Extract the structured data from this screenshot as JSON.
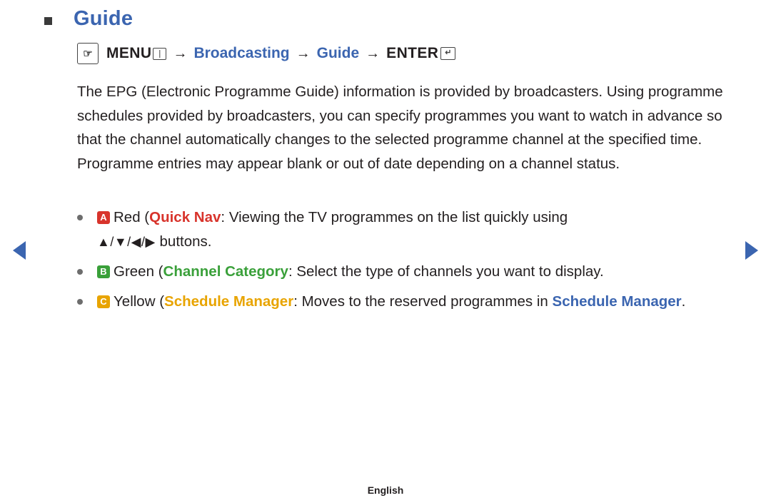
{
  "page": {
    "title": "Guide",
    "footer": "English"
  },
  "menu_path": {
    "hand_icon": "hand-pointer-icon",
    "menu_label": "MENU",
    "menu_key_icon": "menu-key-icon",
    "arrow": "→",
    "broadcasting_label": "Broadcasting",
    "guide_label": "Guide",
    "enter_label": "ENTER",
    "enter_key_icon": "enter-key-icon"
  },
  "paragraph": "The EPG (Electronic Programme Guide) information is provided by broadcasters. Using programme schedules provided by broadcasters, you can specify programmes you want to watch in advance so that the channel automatically changes to the selected programme channel at the specified time. Programme entries may appear blank or out of date depending on a channel status.",
  "bullets": [
    {
      "key_letter": "A",
      "key_color": "#d8342c",
      "colour_name": "Red",
      "feature": "Quick Nav",
      "text_after": ": Viewing the TV programmes on the list quickly using",
      "second_line_keys": "▲/▼/◀/▶",
      "second_line_text": " buttons."
    },
    {
      "key_letter": "B",
      "key_color": "#3aa03a",
      "colour_name": "Green",
      "feature": "Channel Category",
      "text_after": ": Select the type of channels you want to display."
    },
    {
      "key_letter": "C",
      "key_color": "#e8a400",
      "colour_name": "Yellow",
      "feature": "Schedule Manager",
      "text_after": ": Moves to the reserved programmes in ",
      "link_text": "Schedule Manager",
      "text_end": "."
    }
  ],
  "nav": {
    "prev_icon": "triangle-left-icon",
    "next_icon": "triangle-right-icon"
  }
}
